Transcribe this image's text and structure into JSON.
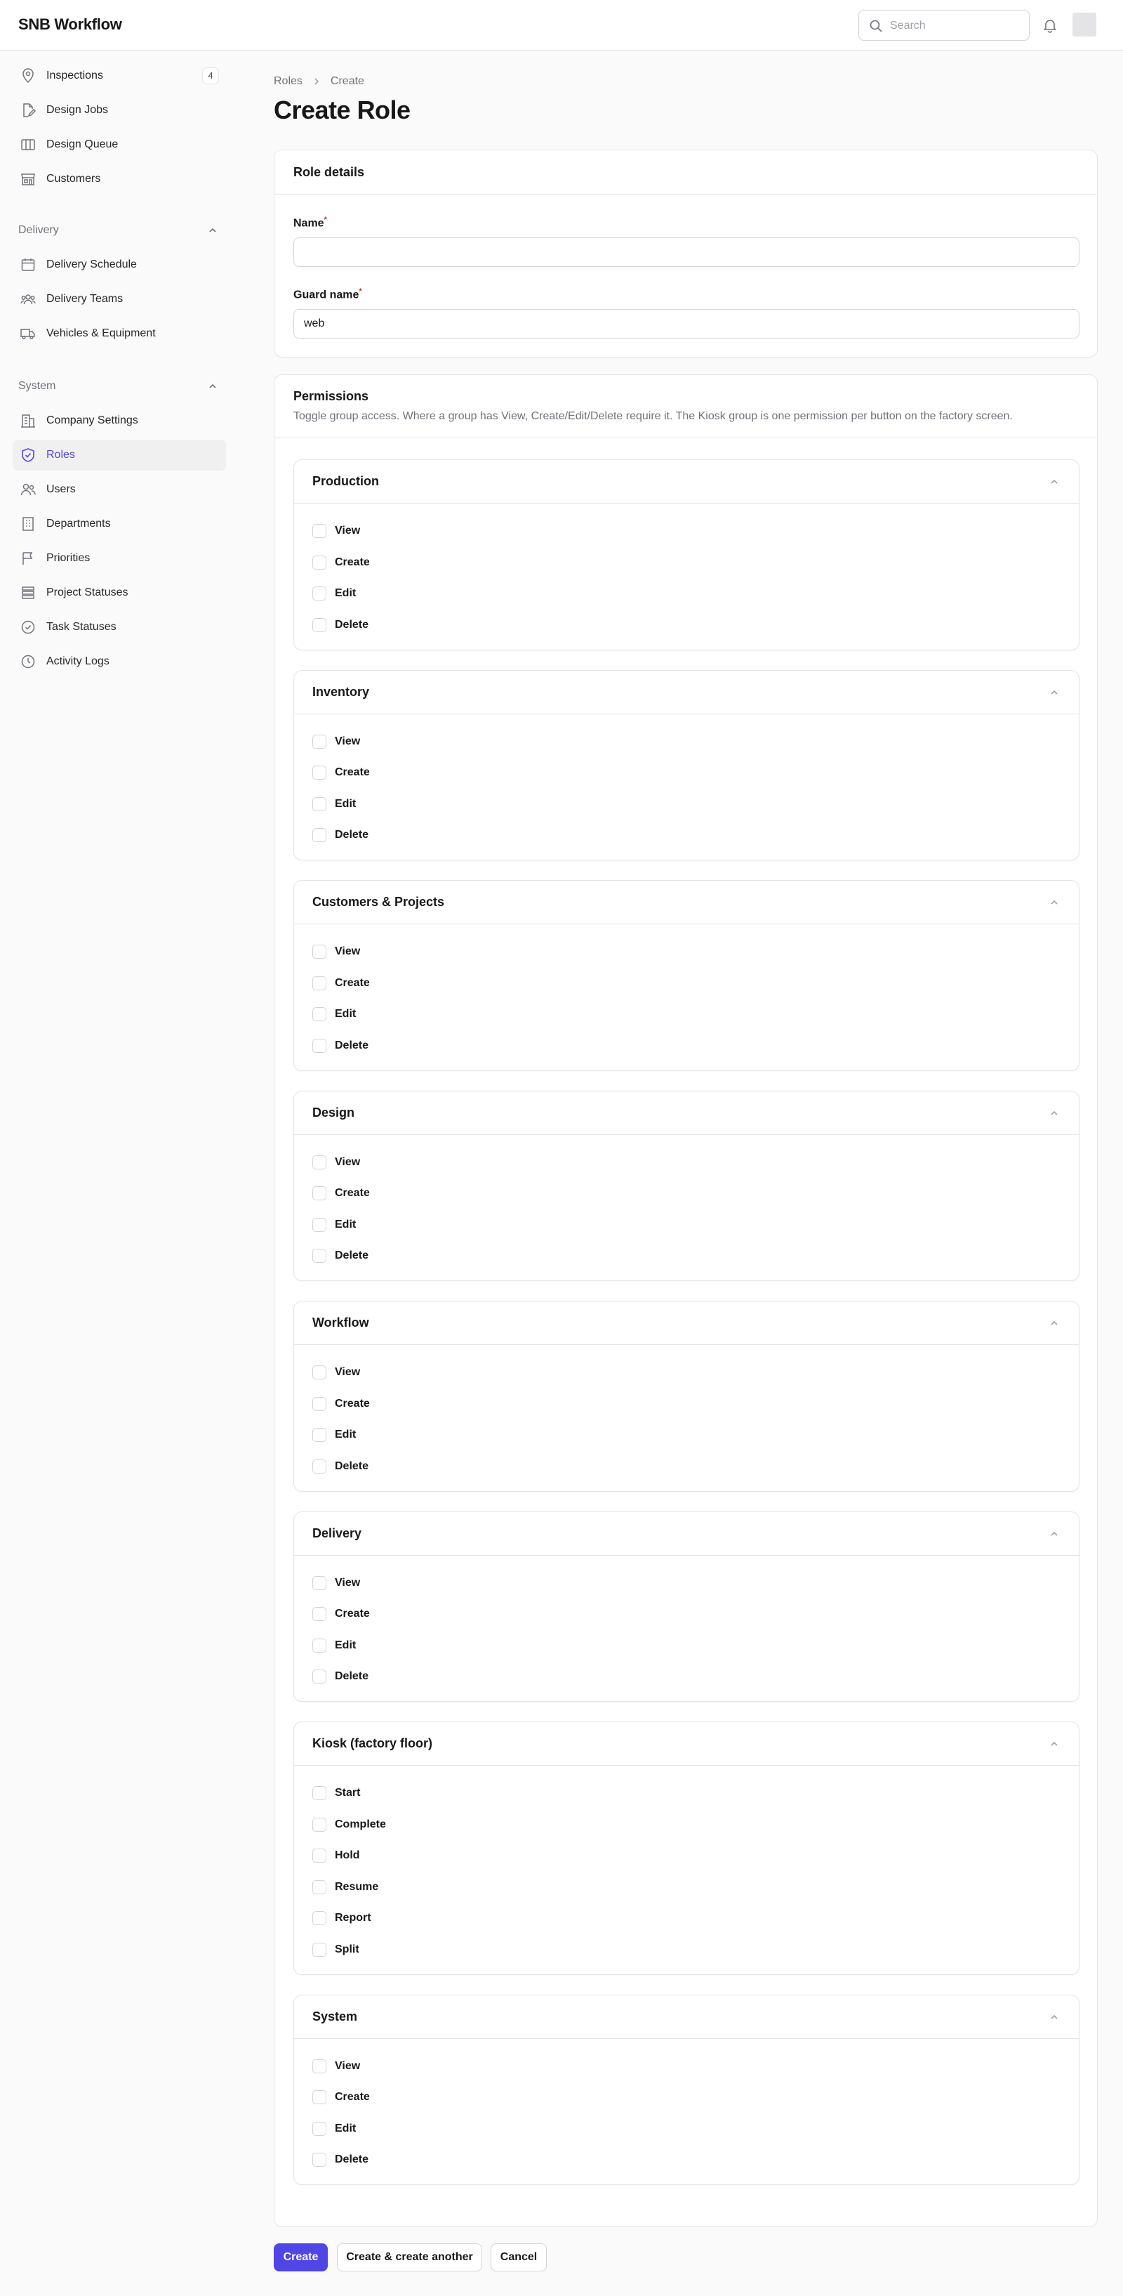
{
  "app": {
    "title": "SNB Workflow"
  },
  "header": {
    "search_placeholder": "Search"
  },
  "sidebar": {
    "items": [
      {
        "label": "Inspections",
        "badge": "4",
        "icon": "map-pin-icon"
      },
      {
        "label": "Design Jobs",
        "icon": "document-pen-icon"
      },
      {
        "label": "Design Queue",
        "icon": "columns-icon"
      },
      {
        "label": "Customers",
        "icon": "storefront-icon"
      }
    ],
    "groups": [
      {
        "label": "Delivery",
        "items": [
          {
            "label": "Delivery Schedule",
            "icon": "calendar-icon"
          },
          {
            "label": "Delivery Teams",
            "icon": "user-group-icon"
          },
          {
            "label": "Vehicles & Equipment",
            "icon": "truck-icon"
          }
        ]
      },
      {
        "label": "System",
        "items": [
          {
            "label": "Company Settings",
            "icon": "building-icon"
          },
          {
            "label": "Roles",
            "icon": "shield-check-icon",
            "active": true
          },
          {
            "label": "Users",
            "icon": "users-icon"
          },
          {
            "label": "Departments",
            "icon": "office-building-icon"
          },
          {
            "label": "Priorities",
            "icon": "flag-icon"
          },
          {
            "label": "Project Statuses",
            "icon": "stack-icon"
          },
          {
            "label": "Task Statuses",
            "icon": "check-circle-icon"
          },
          {
            "label": "Activity Logs",
            "icon": "clock-icon"
          }
        ]
      }
    ]
  },
  "breadcrumb": [
    "Roles",
    "Create"
  ],
  "page": {
    "title": "Create Role"
  },
  "role_details": {
    "title": "Role details",
    "name_label": "Name",
    "name_value": "",
    "guard_label": "Guard name",
    "guard_value": "web",
    "required_mark": "*"
  },
  "permissions": {
    "title": "Permissions",
    "description": "Toggle group access. Where a group has View, Create/Edit/Delete require it. The Kiosk group is one permission per button on the factory screen.",
    "sections": [
      {
        "title": "Production",
        "options": [
          "View",
          "Create",
          "Edit",
          "Delete"
        ]
      },
      {
        "title": "Inventory",
        "options": [
          "View",
          "Create",
          "Edit",
          "Delete"
        ]
      },
      {
        "title": "Customers & Projects",
        "options": [
          "View",
          "Create",
          "Edit",
          "Delete"
        ]
      },
      {
        "title": "Design",
        "options": [
          "View",
          "Create",
          "Edit",
          "Delete"
        ]
      },
      {
        "title": "Workflow",
        "options": [
          "View",
          "Create",
          "Edit",
          "Delete"
        ]
      },
      {
        "title": "Delivery",
        "options": [
          "View",
          "Create",
          "Edit",
          "Delete"
        ]
      },
      {
        "title": "Kiosk (factory floor)",
        "options": [
          "Start",
          "Complete",
          "Hold",
          "Resume",
          "Report",
          "Split"
        ]
      },
      {
        "title": "System",
        "options": [
          "View",
          "Create",
          "Edit",
          "Delete"
        ]
      }
    ]
  },
  "actions": {
    "create": "Create",
    "create_another": "Create & create another",
    "cancel": "Cancel"
  },
  "colors": {
    "accent": "#4f46e5",
    "required": "#dc2626"
  }
}
